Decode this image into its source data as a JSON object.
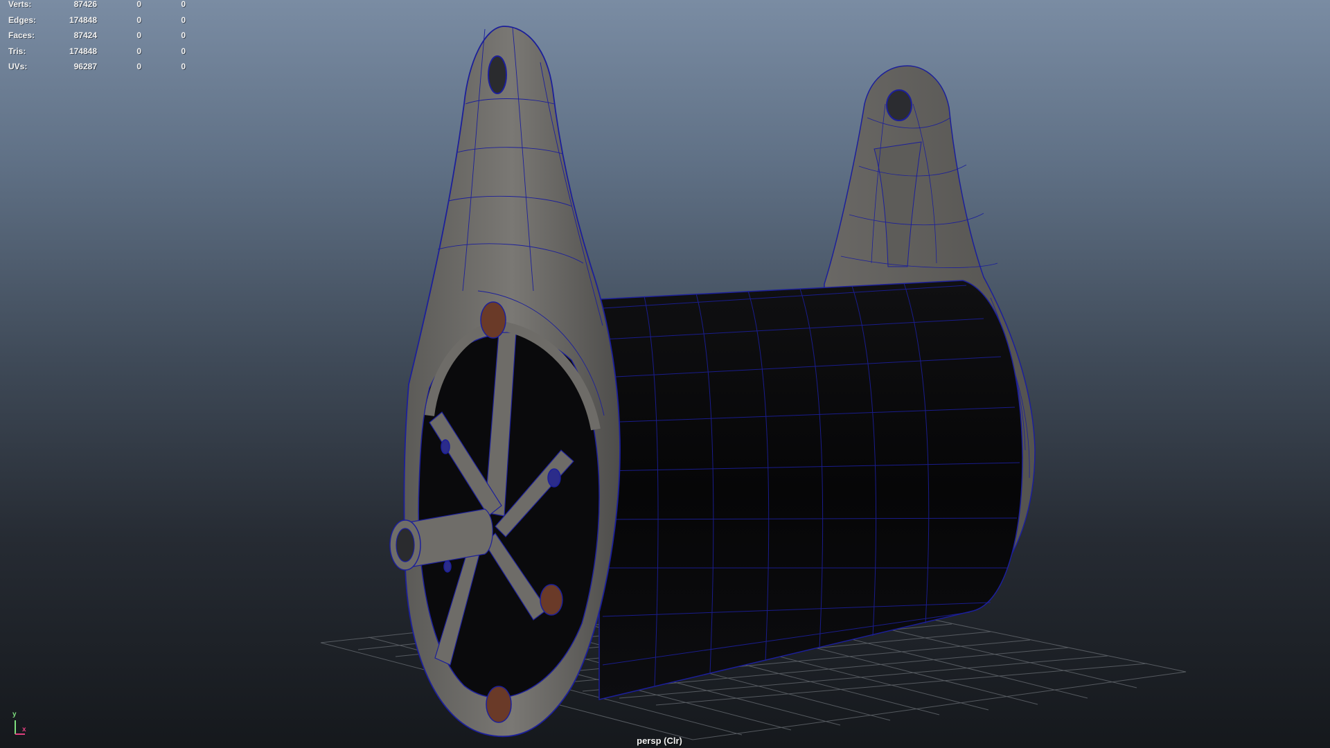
{
  "stats": {
    "rows": [
      {
        "label": "Verts:",
        "v1": "87426",
        "v2": "0",
        "v3": "0"
      },
      {
        "label": "Edges:",
        "v1": "174848",
        "v2": "0",
        "v3": "0"
      },
      {
        "label": "Faces:",
        "v1": "87424",
        "v2": "0",
        "v3": "0"
      },
      {
        "label": "Tris:",
        "v1": "174848",
        "v2": "0",
        "v3": "0"
      },
      {
        "label": "UVs:",
        "v1": "96287",
        "v2": "0",
        "v3": "0"
      }
    ]
  },
  "camera": {
    "label": "persp (Clr)"
  },
  "axis": {
    "y": "y",
    "x": "x",
    "y_color": "#7fe07f",
    "x_color": "#e0407f"
  },
  "colors": {
    "wireframe": "#1c1f9a",
    "mesh": "#6f6d69",
    "cylinder": "#0b0b0d",
    "grid": "#6a6f75",
    "bolt": "#6a3a28"
  }
}
